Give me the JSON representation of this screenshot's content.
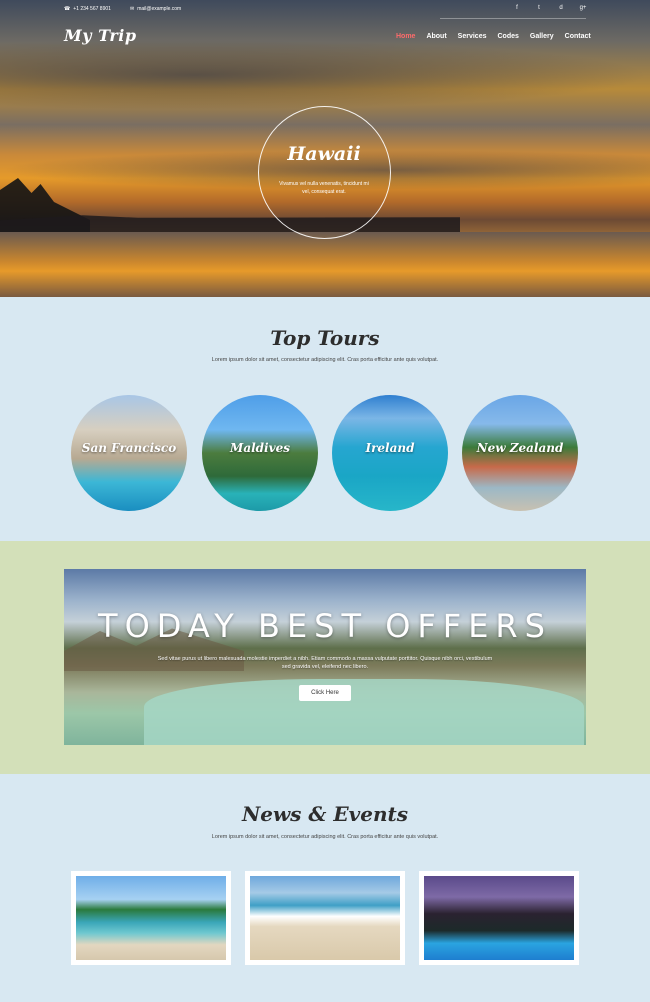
{
  "topbar": {
    "phone": "+1 234 567 8901",
    "email": "mail@example.com",
    "social": [
      "f",
      "t",
      "d",
      "g+"
    ]
  },
  "header": {
    "logo": "My Trip",
    "nav": [
      "Home",
      "About",
      "Services",
      "Codes",
      "Gallery",
      "Contact"
    ],
    "active": "Home"
  },
  "hero": {
    "title": "Hawaii",
    "description": "Vivamus vel nulla venenatis, tincidunt mi vel, consequat erat."
  },
  "tours": {
    "title": "Top Tours",
    "subtitle": "Lorem ipsum dolor sit amet, consectetur adipiscing elit. Cras porta efficitur ante quis volutpat.",
    "items": [
      "San Francisco",
      "Maldives",
      "Ireland",
      "New Zealand"
    ]
  },
  "offers": {
    "headline": "TODAY BEST OFFERS",
    "text": "Sed vitae purus ut libero malesuada molestie imperdiet a nibh. Etiam commodo a massa vulputate porttitor. Quisque nibh orci, vestibulum sed gravida vel, eleifend nec libero.",
    "button": "Click Here"
  },
  "news": {
    "title": "News & Events",
    "subtitle": "Lorem ipsum dolor sit amet, consectetur adipiscing elit. Cras porta efficitur ante quis volutpat."
  },
  "colors": {
    "nav_active": "#ff6b6b",
    "tours_bg": "#d8e8f2",
    "offers_bg": "#d3e0b9"
  }
}
